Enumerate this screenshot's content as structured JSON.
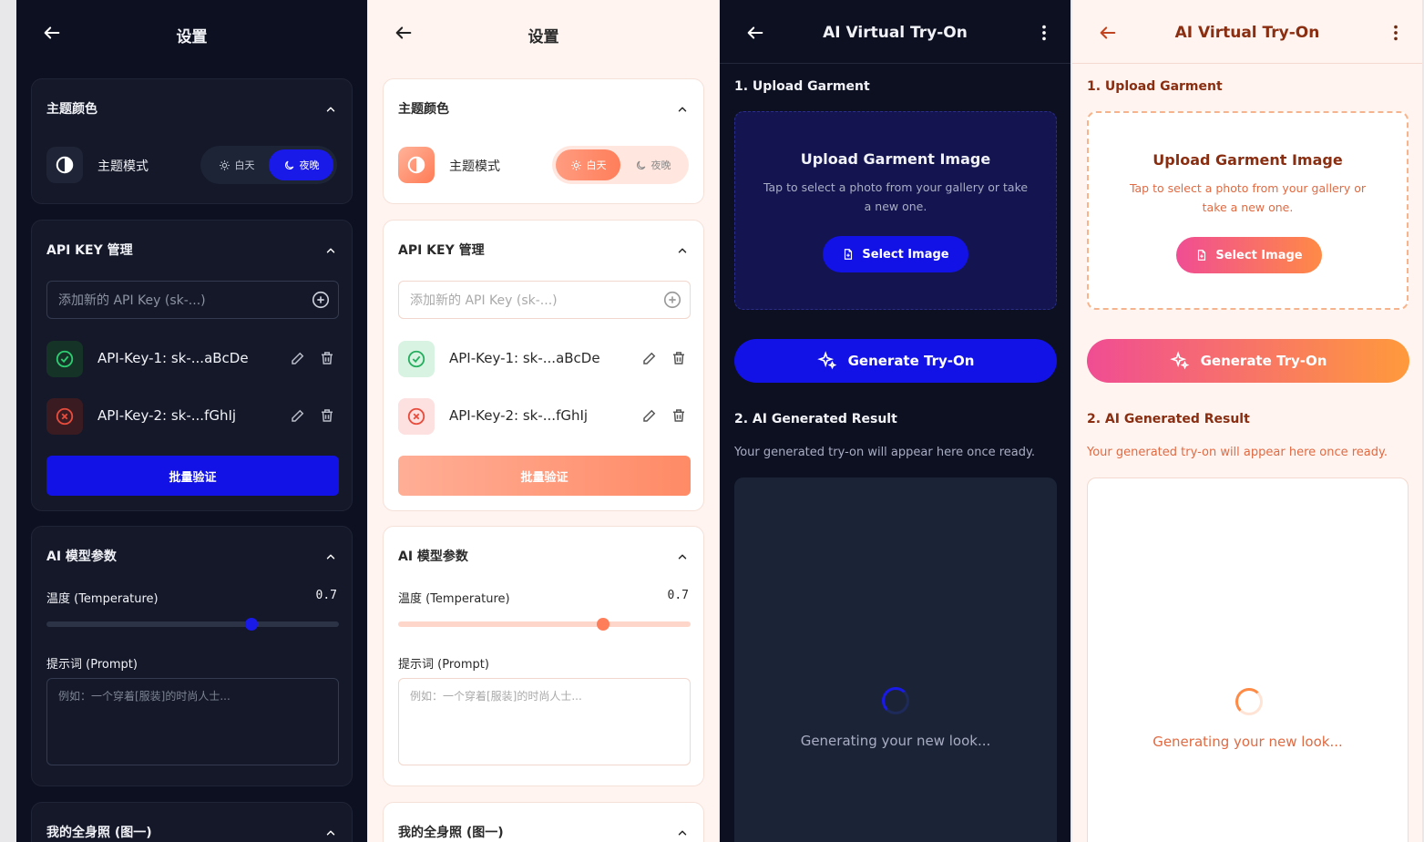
{
  "settings": {
    "title": "设置",
    "theme_card": {
      "title": "主题颜色",
      "mode_label": "主题模式",
      "day_label": "白天",
      "night_label": "夜晚"
    },
    "api_card": {
      "title": "API KEY 管理",
      "input_placeholder": "添加新的 API Key (sk-...)",
      "keys": [
        {
          "label": "API-Key-1: sk-...aBcDe",
          "status": "valid"
        },
        {
          "label": "API-Key-2: sk-...fGhIj",
          "status": "invalid"
        }
      ],
      "bulk_button": "批量验证"
    },
    "model_card": {
      "title": "AI 模型参数",
      "temperature_label": "温度 (Temperature)",
      "temperature_value": "0.7",
      "temperature_fraction": 0.7,
      "prompt_label": "提示词 (Prompt)",
      "prompt_placeholder": "例如：一个穿着[服装]的时尚人士..."
    },
    "photo_card": {
      "title": "我的全身照 (图一)"
    }
  },
  "tryon": {
    "title": "AI Virtual Try-On",
    "upload_section": "1. Upload Garment",
    "upload_title": "Upload Garment Image",
    "upload_desc": "Tap to select a photo from your gallery or take a new one.",
    "select_button": "Select Image",
    "generate_button": "Generate Try-On",
    "result_section": "2. AI Generated Result",
    "result_desc": "Your generated try-on will appear here once ready.",
    "generating_text": "Generating your new look..."
  },
  "colors": {
    "dark_bg": "#0d1020",
    "dark_accent": "#1212e6",
    "light_bg": "#fff4f0",
    "light_accent": "#ff7e5a",
    "pink_accent": "#f04d93"
  }
}
